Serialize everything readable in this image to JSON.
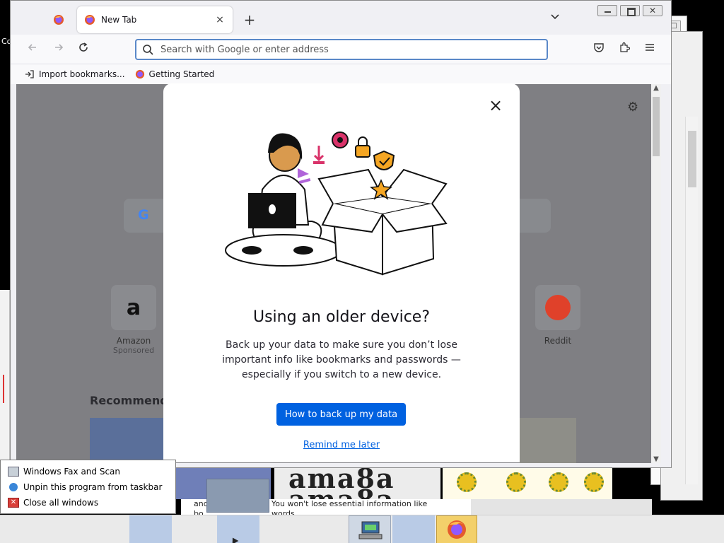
{
  "browser": {
    "tab": {
      "title": "New Tab",
      "close_glyph": "×"
    },
    "newtab_glyph": "+",
    "urlbar": {
      "placeholder": "Search with Google or enter address"
    },
    "bookmarks": [
      {
        "label": "Import bookmarks...",
        "icon": "import-icon"
      },
      {
        "label": "Getting Started",
        "icon": "firefox-icon"
      }
    ],
    "toolbar_icons": [
      "back-icon",
      "forward-icon",
      "reload-icon",
      "pocket-icon",
      "extensions-icon",
      "menu-icon"
    ]
  },
  "newtab": {
    "shortcuts": [
      {
        "name": "Amazon",
        "sponsor": "Sponsored",
        "glyph": "a"
      },
      {
        "name": "Reddit",
        "sponsor": "",
        "glyph": ""
      }
    ],
    "recommended_heading": "Recommende"
  },
  "modal": {
    "close_glyph": "×",
    "title": "Using an older device?",
    "body": "Back up your data to make sure you don’t lose important info like bookmarks and passwords — especially if you switch to a new device.",
    "primary_label": "How to back up my data",
    "secondary_label": "Remind me later"
  },
  "jumplist": {
    "items": [
      {
        "label": "Windows Fax and Scan",
        "icon": "fax-icon"
      },
      {
        "label": "Unpin this program from taskbar",
        "icon": "unpin-icon"
      },
      {
        "label": "Close all windows",
        "icon": "close-window-icon"
      }
    ]
  },
  "desktop": {
    "left_text": "Co",
    "doc_text": {
      "a": "and",
      "b": "You won't lose essential information like",
      "c": "bo",
      "d": "words"
    }
  },
  "colors": {
    "accent": "#0061e0",
    "modal_button": "#0061e0",
    "content_overlay": "#7f7f83"
  }
}
